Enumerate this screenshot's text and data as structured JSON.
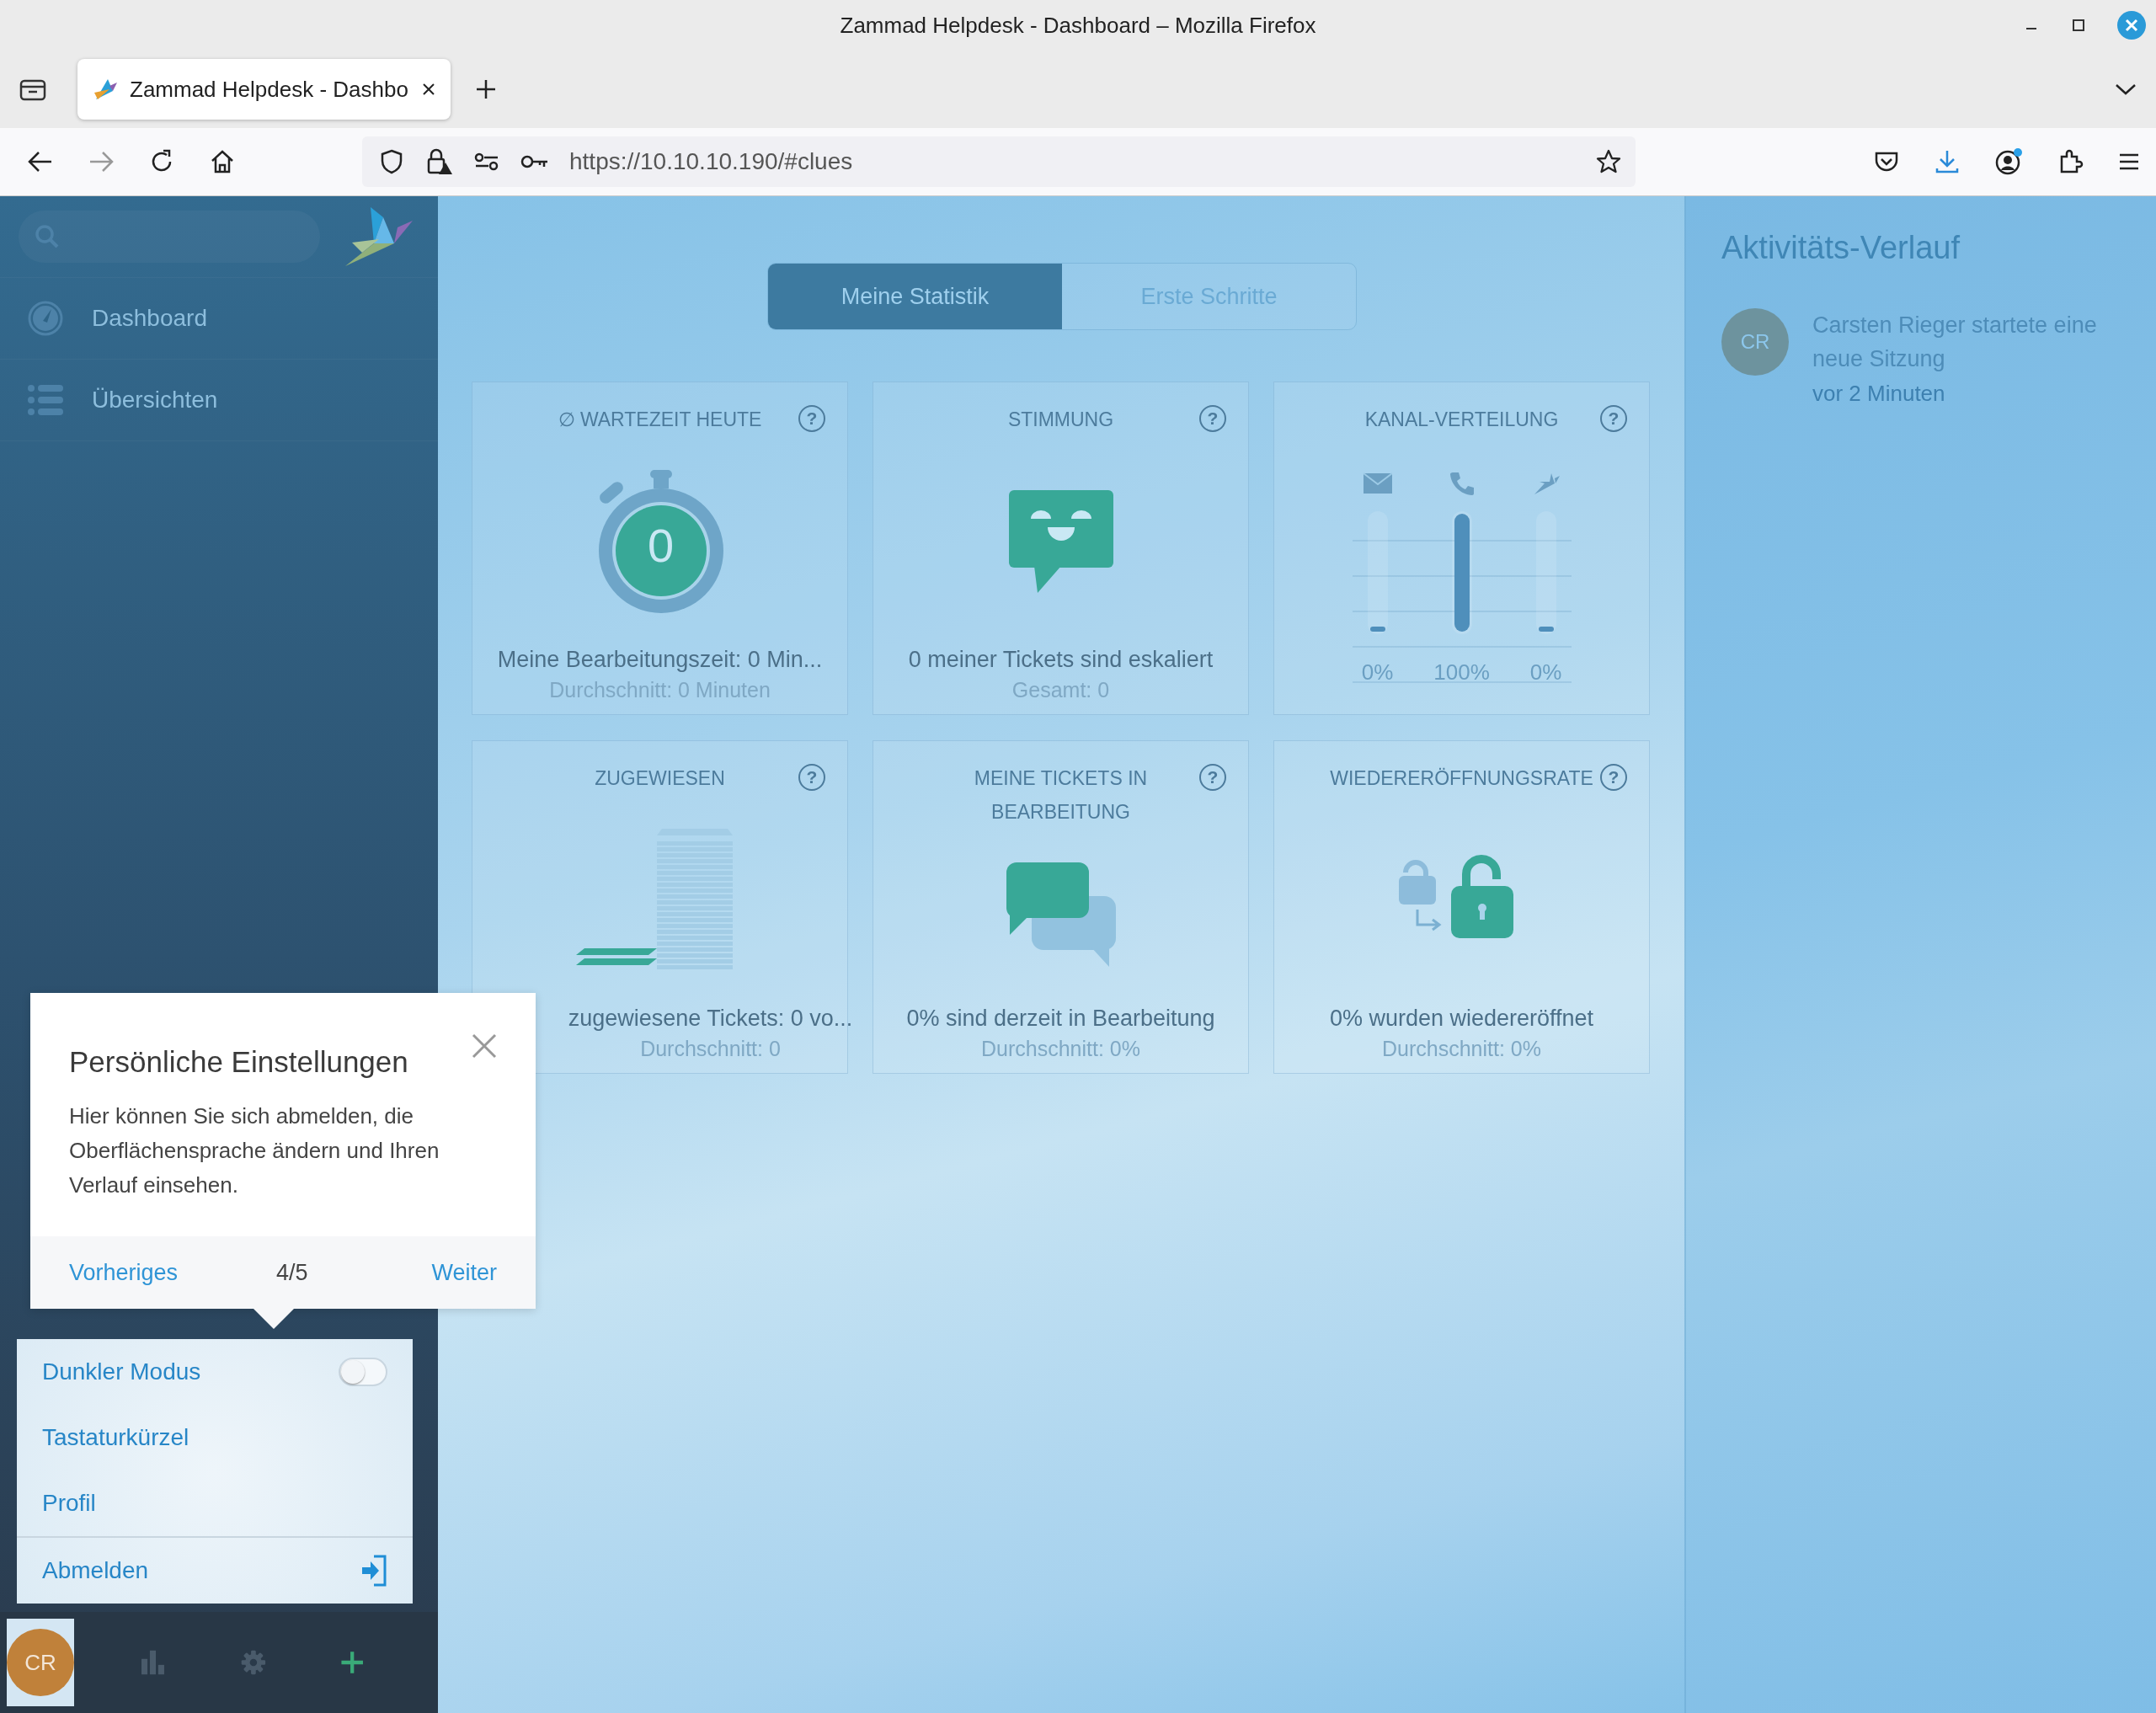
{
  "window": {
    "title": "Zammad Helpdesk - Dashboard – Mozilla Firefox"
  },
  "browser": {
    "tabs": [
      {
        "label": "Zammad Helpdesk - Dashbo",
        "selected": true
      }
    ],
    "url": "https://10.10.10.190/#clues"
  },
  "sidebar": {
    "items": [
      {
        "label": "Dashboard",
        "kind": "dashboard"
      },
      {
        "label": "Übersichten",
        "kind": "list"
      }
    ]
  },
  "dashboard_tabs": [
    {
      "label": "Meine Statistik",
      "selected": true
    },
    {
      "label": "Erste Schritte",
      "selected": false
    }
  ],
  "widgets": [
    {
      "kind": "stopwatch",
      "title": "∅ WARTEZEIT HEUTE",
      "help": "?",
      "value": "0",
      "main": "Meine Bearbeitungszeit: 0 Min...",
      "sub": "Durchschnitt: 0 Minuten"
    },
    {
      "kind": "mood",
      "title": "STIMMUNG",
      "help": "?",
      "main": "0 meiner Tickets sind eskaliert",
      "sub": "Gesamt: 0"
    },
    {
      "kind": "channels",
      "title": "KANAL-VERTEILUNG",
      "help": "?",
      "channels": [
        {
          "kind": "email",
          "level": 0,
          "reading": "0%"
        },
        {
          "kind": "phone",
          "level": 1,
          "reading": "100%"
        },
        {
          "kind": "bird",
          "level": 0,
          "reading": "0%"
        }
      ]
    },
    {
      "kind": "assigned",
      "title": "ZUGEWIESEN",
      "help": "?",
      "main": "zugewiesene Tickets: 0 vo...",
      "sub": "Durchschnitt: 0"
    },
    {
      "kind": "progress",
      "title": "MEINE TICKETS IN BEARBEITUNG",
      "help": "?",
      "main": "0% sind derzeit in Bearbeitung",
      "sub": "Durchschnitt: 0%"
    },
    {
      "kind": "reopen",
      "title": "WIEDERERÖFFNUNGSRATE",
      "help": "?",
      "main": "0% wurden wiedereröffnet",
      "sub": "Durchschnitt: 0%"
    }
  ],
  "activity": {
    "title": "Aktivitäts-Verlauf",
    "items": [
      {
        "avatar": "CR",
        "text": "Carsten Rieger startete eine neue Sitzung",
        "time": "vor 2 Minuten"
      }
    ]
  },
  "tour": {
    "title": "Persönliche Einstellungen",
    "body": "Hier können Sie sich abmelden, die Oberflächensprache ändern und Ihren Verlauf einsehen.",
    "previous": "Vorheriges",
    "counter": "4/5",
    "next": "Weiter"
  },
  "user_menu": [
    {
      "kind": "toggle",
      "label": "Dunkler Modus",
      "on": false
    },
    {
      "kind": "link",
      "label": "Tastaturkürzel"
    },
    {
      "kind": "link",
      "label": "Profil"
    },
    {
      "kind": "logout",
      "label": "Abmelden"
    }
  ],
  "bottom_bar": {
    "avatar": "CR",
    "avatar_selected": true
  }
}
